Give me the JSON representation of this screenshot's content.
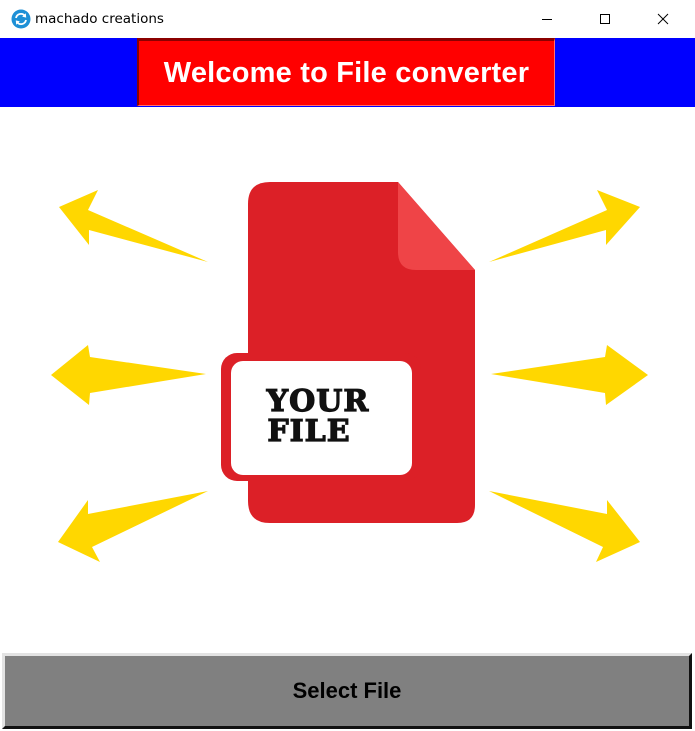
{
  "window": {
    "title": "machado creations",
    "controls": [
      "minimize",
      "maximize",
      "close"
    ]
  },
  "header": {
    "title": "Welcome to File converter"
  },
  "illustration": {
    "file_label_line1": "YOUR",
    "file_label_line2": "FILE",
    "colors": {
      "file_body": "#dc2027",
      "file_fold": "#ef4447",
      "arrows": "#ffd700",
      "label_bg": "#ffffff"
    },
    "arrow_count": 6
  },
  "actions": {
    "select_file_label": "Select File"
  },
  "colors": {
    "header_band": "#0000ff",
    "header_banner": "#ff0000",
    "button_bg": "#808080"
  }
}
